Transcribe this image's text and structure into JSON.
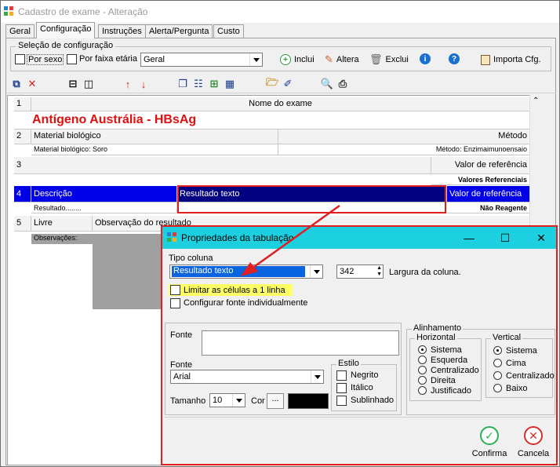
{
  "window": {
    "title": "Cadastro de exame - Alteração"
  },
  "tabs": [
    "Geral",
    "Configuração",
    "Instruções",
    "Alerta/Pergunta",
    "Custo"
  ],
  "config": {
    "legend": "Seleção de configuração",
    "por_sexo": "Por sexo",
    "por_faixa": "Por faixa etária",
    "combo_value": "Geral",
    "btn_inclui": "Inclui",
    "btn_altera": "Altera",
    "btn_exclui": "Exclui",
    "btn_importa": "Importa Cfg."
  },
  "grid": {
    "r1_num": "1",
    "r1_header": "Nome do exame",
    "exam_name": "Antígeno Austrália - HBsAg",
    "r2_num": "2",
    "r2_left": "Material biológico",
    "r2_right": "Método",
    "r2_sub_left": "Material biológico: Soro",
    "r2_sub_right": "Método: Enzimaimunoensaio",
    "r3_num": "3",
    "r3_right": "Valor de referência",
    "r3_sub_right": "Valores Referenciais",
    "r4_num": "4",
    "r4_c1": "Descrição",
    "r4_c2": "Resultado texto",
    "r4_c3": "Valor de referência",
    "r4_sub_left": "Resultado........",
    "r4_sub_right": "Não Reagente",
    "r5_num": "5",
    "r5_c1": "Livre",
    "r5_c2": "Observação do resultado",
    "r5_sub_left": "Observações:"
  },
  "dialog": {
    "title": "Propriedades da tabulação",
    "tipo_coluna_label": "Tipo coluna",
    "tipo_coluna_value": "Resultado texto",
    "largura_value": "342",
    "largura_label": "Largura da coluna.",
    "limitar_label": "Limitar as células a 1 linha",
    "configurar_label": "Configurar fonte individualmente",
    "fonte_label": "Fonte",
    "fonte_label2": "Fonte",
    "fonte_value": "Arial",
    "tamanho_label": "Tamanho",
    "tamanho_value": "10",
    "cor_label": "Cor",
    "cor_btn": "...",
    "estilo_legend": "Estilo",
    "negrito": "Negrito",
    "italico": "Itálico",
    "sublinhado": "Sublinhado",
    "alinhamento_legend": "Alinhamento",
    "horizontal_legend": "Horizontal",
    "vertical_legend": "Vertical",
    "h_options": [
      "Sistema",
      "Esquerda",
      "Centralizado",
      "Direita",
      "Justificado"
    ],
    "v_options": [
      "Sistema",
      "Cima",
      "Centralizado",
      "Baixo"
    ],
    "confirma": "Confirma",
    "cancela": "Cancela"
  },
  "colors": {
    "highlight": "#ffff66",
    "selection": "#0000e8",
    "accent_red": "#e02020",
    "dialog_title": "#1dd0e0"
  }
}
